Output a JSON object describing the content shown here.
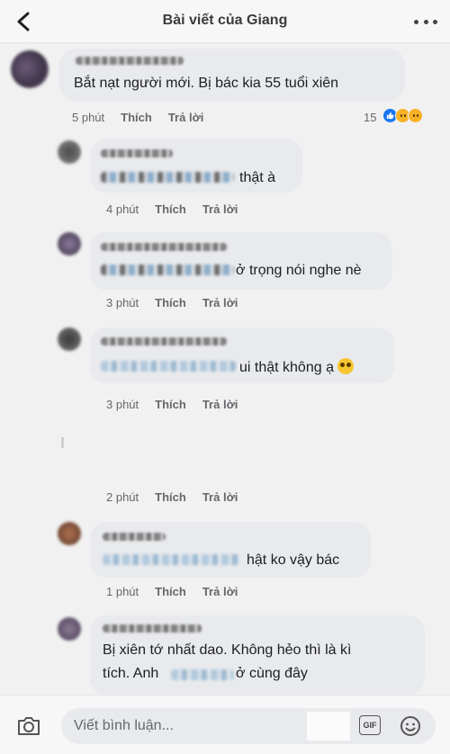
{
  "header": {
    "title": "Bài viết của Giang",
    "back_icon": "chevron-left-icon",
    "more_icon": "more-dots-icon"
  },
  "comments": [
    {
      "text_visible": "Bắt nạt người mới. Bị bác kia 55 tuổi xiên",
      "time": "5 phút",
      "like": "Thích",
      "reply": "Trả lời",
      "reaction_count": "15",
      "reactions": [
        "like",
        "wow",
        "sad"
      ]
    },
    {
      "text_visible": "thật à",
      "time": "4 phút",
      "like": "Thích",
      "reply": "Trả lời"
    },
    {
      "text_visible": "ở trọng nói nghe nè",
      "time": "3 phút",
      "like": "Thích",
      "reply": "Trả lời"
    },
    {
      "text_visible": "ui thật không ạ",
      "time": "3 phút",
      "like": "Thích",
      "reply": "Trả lời"
    },
    {
      "time": "2 phút",
      "like": "Thích",
      "reply": "Trả lời"
    },
    {
      "text_visible": "hật ko vậy bác",
      "time": "1 phút",
      "like": "Thích",
      "reply": "Trả lời"
    },
    {
      "text_line1": "Bị xiên tớ nhất dao. Không hẻo thì là kì",
      "text_line2_start": "tích. Anh",
      "text_line2_end": "ở cùng đây"
    }
  ],
  "composer": {
    "placeholder": "Viết bình luận...",
    "gif_label": "GIF",
    "camera_icon": "camera-icon",
    "sticker_icon": "smiley-icon"
  },
  "colors": {
    "bubble": "#e9eaed",
    "meta_text": "#65676b",
    "like_blue": "#1877f2",
    "reaction_yellow": "#f7b125"
  }
}
